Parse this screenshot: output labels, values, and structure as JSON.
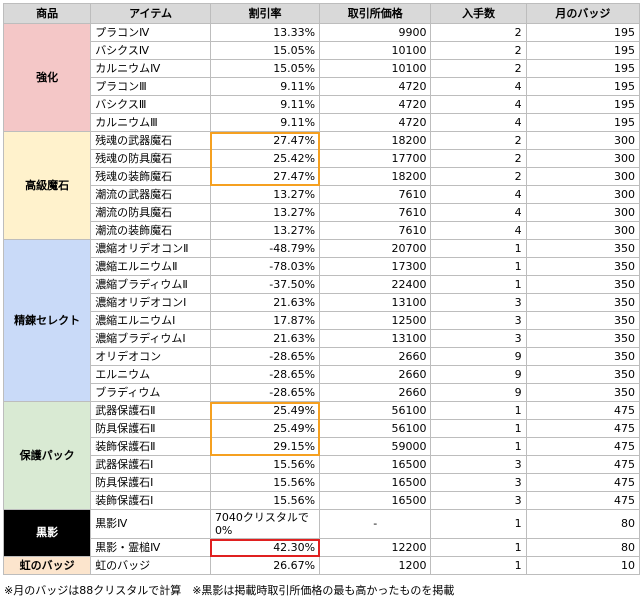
{
  "headers": [
    "商品",
    "アイテム",
    "割引率",
    "取引所価格",
    "入手数",
    "月のバッジ"
  ],
  "groups": [
    {
      "category": "強化",
      "color": "#f4c7c7",
      "text_color": "#000000",
      "rows": [
        {
          "item": "プラコンⅣ",
          "rate": "13.33%",
          "price": "9900",
          "qty": "2",
          "badge": "195"
        },
        {
          "item": "バシクスⅣ",
          "rate": "15.05%",
          "price": "10100",
          "qty": "2",
          "badge": "195"
        },
        {
          "item": "カルニウムⅣ",
          "rate": "15.05%",
          "price": "10100",
          "qty": "2",
          "badge": "195"
        },
        {
          "item": "プラコンⅢ",
          "rate": "9.11%",
          "price": "4720",
          "qty": "4",
          "badge": "195"
        },
        {
          "item": "バシクスⅢ",
          "rate": "9.11%",
          "price": "4720",
          "qty": "4",
          "badge": "195"
        },
        {
          "item": "カルニウムⅢ",
          "rate": "9.11%",
          "price": "4720",
          "qty": "4",
          "badge": "195"
        }
      ]
    },
    {
      "category": "高級魔石",
      "color": "#fff2cc",
      "text_color": "#000000",
      "rows": [
        {
          "item": "残魂の武器魔石",
          "rate": "27.47%",
          "price": "18200",
          "qty": "2",
          "badge": "300"
        },
        {
          "item": "残魂の防具魔石",
          "rate": "25.42%",
          "price": "17700",
          "qty": "2",
          "badge": "300"
        },
        {
          "item": "残魂の装飾魔石",
          "rate": "27.47%",
          "price": "18200",
          "qty": "2",
          "badge": "300"
        },
        {
          "item": "潮流の武器魔石",
          "rate": "13.27%",
          "price": "7610",
          "qty": "4",
          "badge": "300"
        },
        {
          "item": "潮流の防具魔石",
          "rate": "13.27%",
          "price": "7610",
          "qty": "4",
          "badge": "300"
        },
        {
          "item": "潮流の装飾魔石",
          "rate": "13.27%",
          "price": "7610",
          "qty": "4",
          "badge": "300"
        }
      ]
    },
    {
      "category": "精錬セレクト",
      "color": "#c9daf8",
      "text_color": "#000000",
      "rows": [
        {
          "item": "濃縮オリデオコンⅡ",
          "rate": "-48.79%",
          "price": "20700",
          "qty": "1",
          "badge": "350"
        },
        {
          "item": "濃縮エルニウムⅡ",
          "rate": "-78.03%",
          "price": "17300",
          "qty": "1",
          "badge": "350"
        },
        {
          "item": "濃縮ブラディウムⅡ",
          "rate": "-37.50%",
          "price": "22400",
          "qty": "1",
          "badge": "350"
        },
        {
          "item": "濃縮オリデオコンⅠ",
          "rate": "21.63%",
          "price": "13100",
          "qty": "3",
          "badge": "350"
        },
        {
          "item": "濃縮エルニウムⅠ",
          "rate": "17.87%",
          "price": "12500",
          "qty": "3",
          "badge": "350"
        },
        {
          "item": "濃縮ブラディウムⅠ",
          "rate": "21.63%",
          "price": "13100",
          "qty": "3",
          "badge": "350"
        },
        {
          "item": "オリデオコン",
          "rate": "-28.65%",
          "price": "2660",
          "qty": "9",
          "badge": "350"
        },
        {
          "item": "エルニウム",
          "rate": "-28.65%",
          "price": "2660",
          "qty": "9",
          "badge": "350"
        },
        {
          "item": "ブラディウム",
          "rate": "-28.65%",
          "price": "2660",
          "qty": "9",
          "badge": "350"
        }
      ]
    },
    {
      "category": "保護パック",
      "color": "#d9ead3",
      "text_color": "#000000",
      "rows": [
        {
          "item": "武器保護石Ⅱ",
          "rate": "25.49%",
          "price": "56100",
          "qty": "1",
          "badge": "475"
        },
        {
          "item": "防具保護石Ⅱ",
          "rate": "25.49%",
          "price": "56100",
          "qty": "1",
          "badge": "475"
        },
        {
          "item": "装飾保護石Ⅱ",
          "rate": "29.15%",
          "price": "59000",
          "qty": "1",
          "badge": "475"
        },
        {
          "item": "武器保護石Ⅰ",
          "rate": "15.56%",
          "price": "16500",
          "qty": "3",
          "badge": "475"
        },
        {
          "item": "防具保護石Ⅰ",
          "rate": "15.56%",
          "price": "16500",
          "qty": "3",
          "badge": "475"
        },
        {
          "item": "装飾保護石Ⅰ",
          "rate": "15.56%",
          "price": "16500",
          "qty": "3",
          "badge": "475"
        }
      ]
    },
    {
      "category": "黒影",
      "color": "#000000",
      "text_color": "#ffffff",
      "rows": [
        {
          "item": "黒影Ⅳ",
          "rate": "7040クリスタルで0%",
          "price": "-",
          "qty": "1",
          "badge": "80"
        },
        {
          "item": "黒影・霊槌Ⅳ",
          "rate": "42.30%",
          "price": "12200",
          "qty": "1",
          "badge": "80"
        }
      ]
    },
    {
      "category": "虹のバッジ",
      "color": "#fce5cd",
      "text_color": "#000000",
      "rows": [
        {
          "item": "虹のバッジ",
          "rate": "26.67%",
          "price": "1200",
          "qty": "1",
          "badge": "10"
        }
      ]
    }
  ],
  "highlight_colors": {
    "orange": "#f5a020",
    "red": "#e02020"
  },
  "note": "※月のバッジは88クリスタルで計算　※黒影は掲載時取引所価格の最も高かったものを掲載"
}
